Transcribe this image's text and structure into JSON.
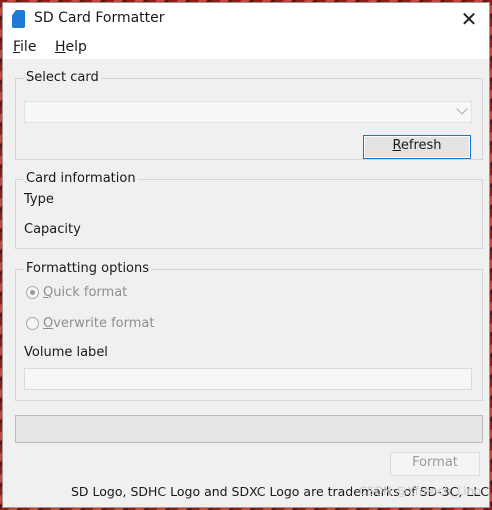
{
  "window": {
    "title": "SD Card Formatter",
    "close_glyph": "✕"
  },
  "menu": {
    "file": {
      "accel": "F",
      "rest": "ile"
    },
    "help": {
      "accel": "H",
      "rest": "elp"
    }
  },
  "select_card": {
    "label": "Select card",
    "selected_value": "",
    "refresh": {
      "accel": "R",
      "rest": "efresh"
    }
  },
  "card_information": {
    "label": "Card information",
    "type_label": "Type",
    "capacity_label": "Capacity"
  },
  "formatting_options": {
    "label": "Formatting options",
    "quick_format": {
      "accel": "Q",
      "rest": "uick format",
      "checked": true
    },
    "overwrite_format": {
      "accel": "O",
      "rest": "verwrite format",
      "checked": false
    },
    "volume_label": "Volume label",
    "volume_value": ""
  },
  "progress": {
    "percent": 0
  },
  "actions": {
    "format_label": "Format"
  },
  "footer": {
    "text": "SD Logo, SDHC Logo and SDXC Logo are trademarks of SD-3C, LLC.",
    "watermark": "CSDN @Xfrench_Lino"
  },
  "colors": {
    "accent": "#1a74d6",
    "window_bg": "#f0f0f0",
    "disabled_text": "#9a9a9a"
  },
  "icons": {
    "app": "sd-card-icon",
    "close": "close-icon",
    "dropdown": "chevron-down-icon"
  }
}
